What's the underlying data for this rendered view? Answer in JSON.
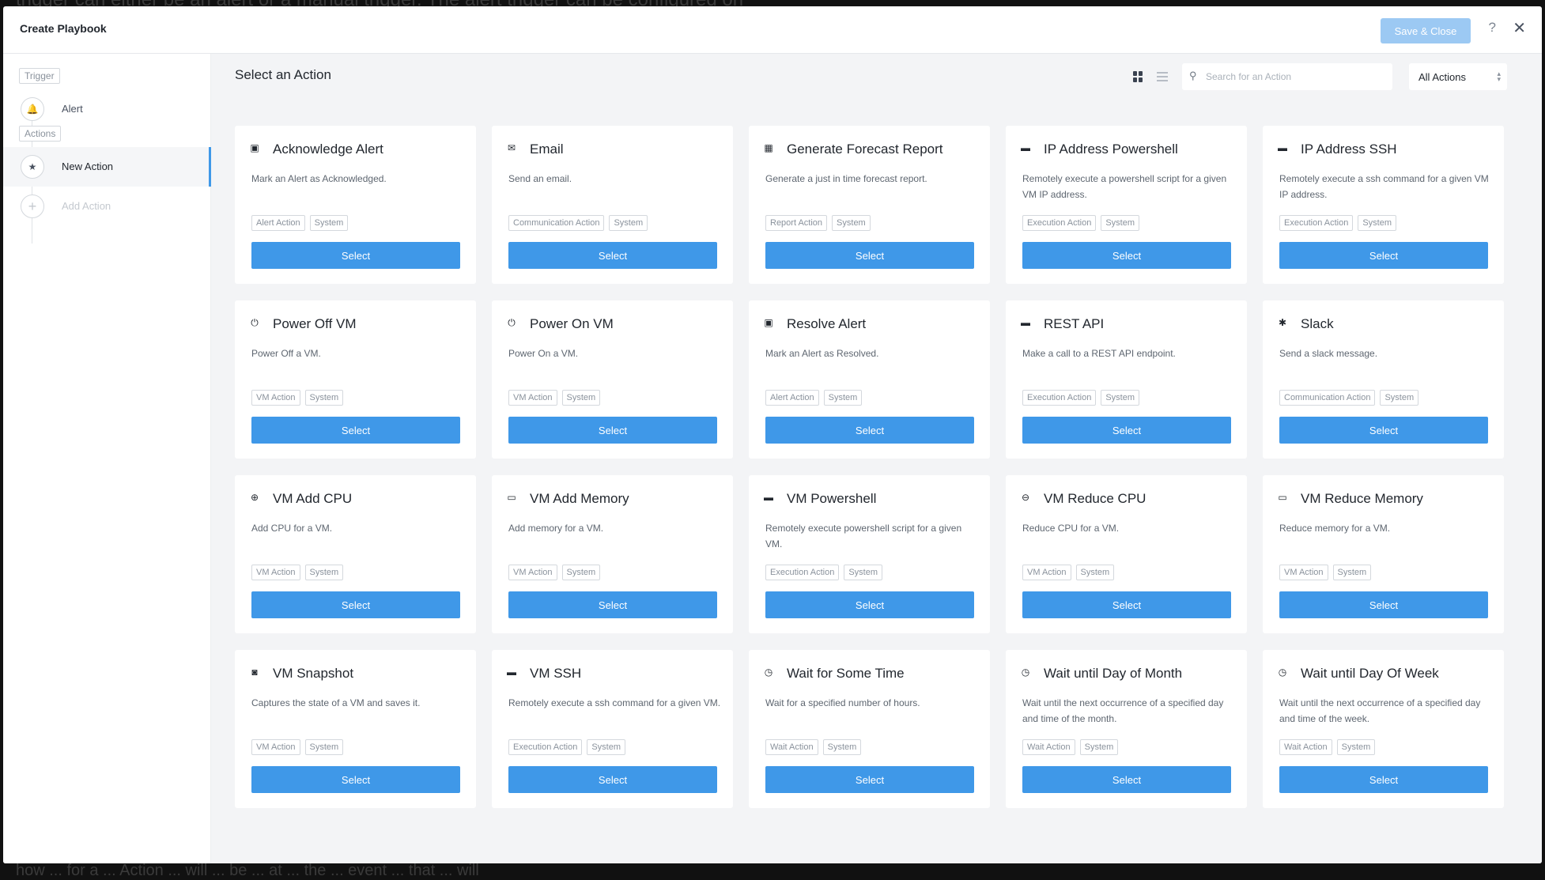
{
  "background": {
    "top_text": "trigger can either be an alert or a manual trigger. The alert trigger can be configured on",
    "bottom_text": "how ... for a ... Action ... will ... be ... at ... the ... event ... that ... will"
  },
  "header": {
    "title": "Create Playbook",
    "save_label": "Save & Close",
    "help_label": "?",
    "close_label": "✕"
  },
  "sidebar": {
    "trigger_tag": "Trigger",
    "trigger_item": "Alert",
    "actions_tag": "Actions",
    "new_action": "New Action",
    "add_action": "Add Action"
  },
  "main": {
    "title": "Select an Action",
    "search_placeholder": "Search for an Action",
    "filter_value": "All Actions",
    "select_label": "Select"
  },
  "actions": [
    {
      "icon": "calendar-check-icon",
      "glyph": "▣",
      "title": "Acknowledge Alert",
      "description": "Mark an Alert as Acknowledged.",
      "tags": [
        "Alert Action",
        "System"
      ]
    },
    {
      "icon": "envelope-icon",
      "glyph": "✉",
      "title": "Email",
      "description": "Send an email.",
      "tags": [
        "Communication Action",
        "System"
      ]
    },
    {
      "icon": "report-icon",
      "glyph": "▦",
      "title": "Generate Forecast Report",
      "description": "Generate a just in time forecast report.",
      "tags": [
        "Report Action",
        "System"
      ]
    },
    {
      "icon": "terminal-icon",
      "glyph": "▬",
      "title": "IP Address Powershell",
      "description": "Remotely execute a powershell script for a given VM IP address.",
      "tags": [
        "Execution Action",
        "System"
      ]
    },
    {
      "icon": "terminal-icon",
      "glyph": "▬",
      "title": "IP Address SSH",
      "description": "Remotely execute a ssh command for a given VM IP address.",
      "tags": [
        "Execution Action",
        "System"
      ]
    },
    {
      "icon": "power-icon",
      "glyph": "⏻",
      "title": "Power Off VM",
      "description": "Power Off a VM.",
      "tags": [
        "VM Action",
        "System"
      ]
    },
    {
      "icon": "power-icon",
      "glyph": "⏻",
      "title": "Power On VM",
      "description": "Power On a VM.",
      "tags": [
        "VM Action",
        "System"
      ]
    },
    {
      "icon": "calendar-check-icon",
      "glyph": "▣",
      "title": "Resolve Alert",
      "description": "Mark an Alert as Resolved.",
      "tags": [
        "Alert Action",
        "System"
      ]
    },
    {
      "icon": "terminal-icon",
      "glyph": "▬",
      "title": "REST API",
      "description": "Make a call to a REST API endpoint.",
      "tags": [
        "Execution Action",
        "System"
      ]
    },
    {
      "icon": "slack-icon",
      "glyph": "✱",
      "title": "Slack",
      "description": "Send a slack message.",
      "tags": [
        "Communication Action",
        "System"
      ]
    },
    {
      "icon": "cpu-icon",
      "glyph": "⊕",
      "title": "VM Add CPU",
      "description": "Add CPU for a VM.",
      "tags": [
        "VM Action",
        "System"
      ]
    },
    {
      "icon": "memory-icon",
      "glyph": "▭",
      "title": "VM Add Memory",
      "description": "Add memory for a VM.",
      "tags": [
        "VM Action",
        "System"
      ]
    },
    {
      "icon": "terminal-icon",
      "glyph": "▬",
      "title": "VM Powershell",
      "description": "Remotely execute powershell script for a given VM.",
      "tags": [
        "Execution Action",
        "System"
      ]
    },
    {
      "icon": "cpu-icon",
      "glyph": "⊖",
      "title": "VM Reduce CPU",
      "description": "Reduce CPU for a VM.",
      "tags": [
        "VM Action",
        "System"
      ]
    },
    {
      "icon": "memory-icon",
      "glyph": "▭",
      "title": "VM Reduce Memory",
      "description": "Reduce memory for a VM.",
      "tags": [
        "VM Action",
        "System"
      ]
    },
    {
      "icon": "camera-icon",
      "glyph": "◙",
      "title": "VM Snapshot",
      "description": "Captures the state of a VM and saves it.",
      "tags": [
        "VM Action",
        "System"
      ]
    },
    {
      "icon": "terminal-icon",
      "glyph": "▬",
      "title": "VM SSH",
      "description": "Remotely execute a ssh command for a given VM.",
      "tags": [
        "Execution Action",
        "System"
      ]
    },
    {
      "icon": "clock-icon",
      "glyph": "◷",
      "title": "Wait for Some Time",
      "description": "Wait for a specified number of hours.",
      "tags": [
        "Wait Action",
        "System"
      ]
    },
    {
      "icon": "clock-icon",
      "glyph": "◷",
      "title": "Wait until Day of Month",
      "description": "Wait until the next occurrence of a specified day and time of the month.",
      "tags": [
        "Wait Action",
        "System"
      ]
    },
    {
      "icon": "clock-icon",
      "glyph": "◷",
      "title": "Wait until Day Of Week",
      "description": "Wait until the next occurrence of a specified day and time of the week.",
      "tags": [
        "Wait Action",
        "System"
      ]
    }
  ],
  "colors": {
    "accent": "#3f98e8",
    "save_disabled": "#9cc9f3",
    "main_bg": "#f3f4f6"
  }
}
